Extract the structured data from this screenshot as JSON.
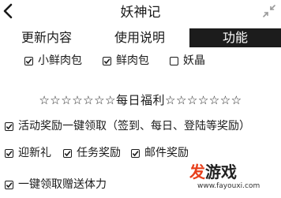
{
  "header": {
    "title": "妖神记"
  },
  "tabs": [
    {
      "label": "更新内容",
      "active": false
    },
    {
      "label": "使用说明",
      "active": false
    },
    {
      "label": "功能",
      "active": true
    }
  ],
  "options_row": [
    {
      "label": "小鲜肉包",
      "checked": true
    },
    {
      "label": "鲜肉包",
      "checked": true
    },
    {
      "label": "妖晶",
      "checked": false
    }
  ],
  "daily_welfare": {
    "banner": "☆☆☆☆☆☆☆每日福利☆☆☆☆☆☆☆"
  },
  "tasks": {
    "activity_rewards": {
      "label": "活动奖励一键领取（签到、每日、登陆等奖励）",
      "checked": true
    },
    "newcomer_gift": {
      "label": "迎新礼",
      "checked": true
    },
    "task_rewards": {
      "label": "任务奖励",
      "checked": true
    },
    "mail_rewards": {
      "label": "邮件奖励",
      "checked": true
    },
    "claim_stamina": {
      "label": "一键领取赠送体力",
      "checked": true
    }
  },
  "watermark": {
    "brand_part1": "发",
    "brand_part2": "游戏",
    "url": "www.fayouxi.com"
  },
  "colors": {
    "active_tab_bg": "#1c1c1c",
    "active_tab_text": "#ffffff",
    "watermark_accent": "#e8401c"
  }
}
